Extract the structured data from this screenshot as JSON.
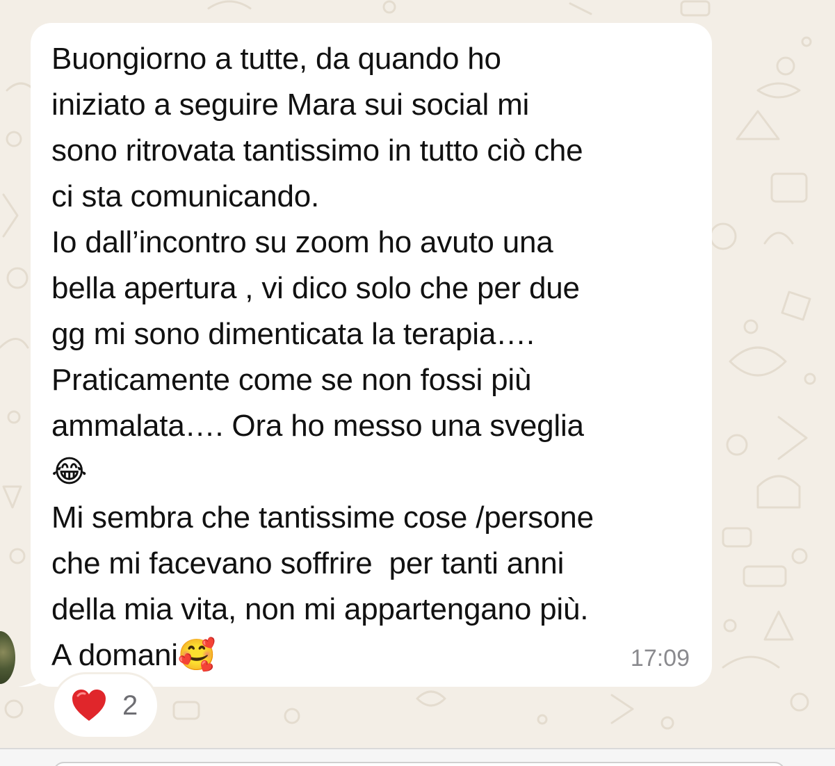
{
  "message": {
    "lines": [
      "Buongiorno a tutte, da quando ho",
      "iniziato a seguire Mara sui social mi",
      "sono ritrovata tantissimo in tutto ciò che",
      "ci sta comunicando.",
      "Io dall’incontro su zoom ho avuto una",
      "bella apertura , vi dico solo che per due",
      "gg mi sono dimenticata la terapia….",
      "Praticamente come se non fossi più",
      "ammalata…. Ora ho messo una sveglia",
      "😂",
      "Mi sembra che tantissime cose /persone",
      "che mi facevano soffrire  per tanti anni",
      "della mia vita, non mi appartengano più.",
      "A domani🥰"
    ],
    "timestamp": "17:09"
  },
  "reaction": {
    "emoji": "heart-icon",
    "count": "2",
    "color": "#e0262b"
  },
  "colors": {
    "background": "#f3eee6",
    "bubble": "#ffffff",
    "text": "#111111",
    "timestamp": "#8a8a8e"
  }
}
